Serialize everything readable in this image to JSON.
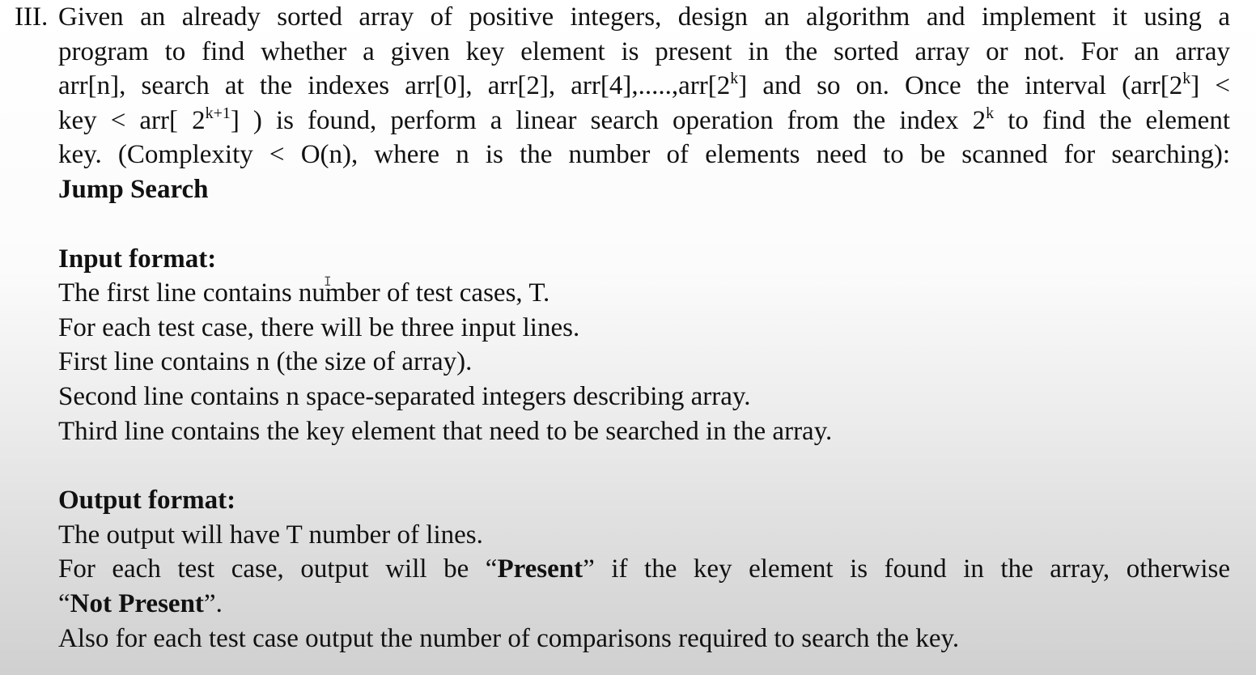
{
  "question": {
    "number_label": "III.",
    "sections": [
      {
        "name": "problem-statement",
        "lines": [
          {
            "justify": true,
            "segments": [
              {
                "text": "Given an already sorted array of positive integers, design an algorithm and implement it using a"
              }
            ]
          },
          {
            "justify": true,
            "segments": [
              {
                "text": "program to find whether a given key element is present in the sorted array or not. For an array"
              }
            ]
          },
          {
            "justify": true,
            "segments": [
              {
                "text": "arr[n], search at the indexes arr[0], arr[2], arr[4],.....,arr[2"
              },
              {
                "text": "k",
                "style": "sup"
              },
              {
                "text": "] and so on. Once the interval (arr[2"
              },
              {
                "text": "k",
                "style": "sup"
              },
              {
                "text": "] <"
              }
            ]
          },
          {
            "justify": true,
            "segments": [
              {
                "text": "key < arr[ 2"
              },
              {
                "text": "k+1",
                "style": "sup"
              },
              {
                "text": "] ) is found, perform a linear search operation from the index 2"
              },
              {
                "text": "k",
                "style": "sup"
              },
              {
                "text": " to find the element"
              }
            ]
          },
          {
            "justify": true,
            "segments": [
              {
                "text": "key. (Complexity < O(n), where n is the number of elements need to be scanned for searching):"
              }
            ]
          },
          {
            "justify": false,
            "segments": [
              {
                "text": "Jump Search",
                "style": "bold"
              }
            ]
          }
        ]
      },
      {
        "name": "input-format",
        "lines": [
          {
            "justify": false,
            "segments": [
              {
                "text": "Input format:",
                "style": "bold"
              }
            ]
          },
          {
            "justify": false,
            "segments": [
              {
                "text": "The first line contains number of test cases, T."
              }
            ]
          },
          {
            "justify": false,
            "segments": [
              {
                "text": "For each test case, there will be three input lines."
              }
            ]
          },
          {
            "justify": false,
            "segments": [
              {
                "text": "First line contains n (the size of array)."
              }
            ]
          },
          {
            "justify": false,
            "segments": [
              {
                "text": "Second line contains n space-separated integers describing array."
              }
            ]
          },
          {
            "justify": false,
            "segments": [
              {
                "text": "Third line contains the key element that need to be searched in the array."
              }
            ]
          }
        ]
      },
      {
        "name": "output-format",
        "lines": [
          {
            "justify": false,
            "segments": [
              {
                "text": "Output format:",
                "style": "bold"
              }
            ]
          },
          {
            "justify": false,
            "segments": [
              {
                "text": "The output will have T number of lines."
              }
            ]
          },
          {
            "justify": true,
            "segments": [
              {
                "text": "For each test case, output will be “"
              },
              {
                "text": "Present",
                "style": "bold"
              },
              {
                "text": "” if the key element is found in the array, otherwise"
              }
            ]
          },
          {
            "justify": false,
            "segments": [
              {
                "text": "“"
              },
              {
                "text": "Not Present",
                "style": "bold"
              },
              {
                "text": "”."
              }
            ]
          },
          {
            "justify": false,
            "segments": [
              {
                "text": "Also for each test case output the number of comparisons required to search the key."
              }
            ]
          }
        ]
      }
    ]
  }
}
